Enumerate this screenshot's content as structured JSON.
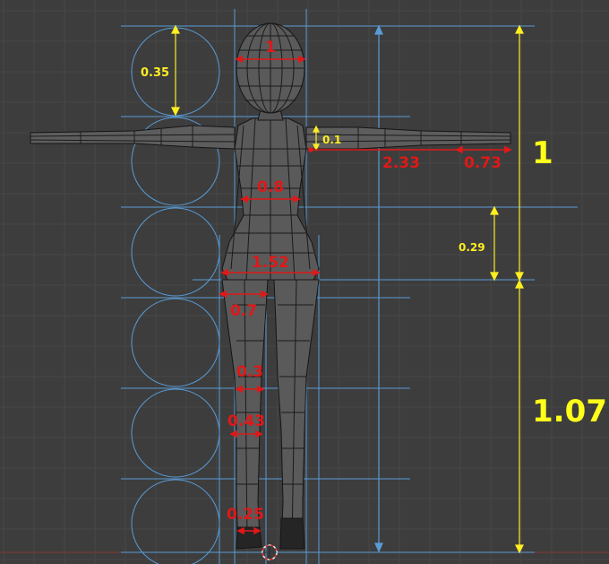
{
  "colors": {
    "background": "#3d3d3d",
    "grid": "#474747",
    "guide_blue": "#5a9bd5",
    "measure_red": "#e01818",
    "measure_yellow": "#ffee22",
    "mesh_wire": "#111111",
    "mesh_fill": "#5a5a5a"
  },
  "labels": {
    "head_width": "1",
    "head_circle_height": "0.35",
    "shoulder_offset": "0.1",
    "arm_length": "2.33",
    "hand_length": "0.73",
    "upper_body_scale": "1",
    "waist_width": "0.8",
    "hip_height": "0.29",
    "hip_width": "1.52",
    "thigh_width": "0.7",
    "knee_width": "0.3",
    "calf_width": "0.43",
    "ankle_width": "0.25",
    "leg_scale": "1.07"
  },
  "icons": {
    "origin": "3d-cursor-icon"
  }
}
